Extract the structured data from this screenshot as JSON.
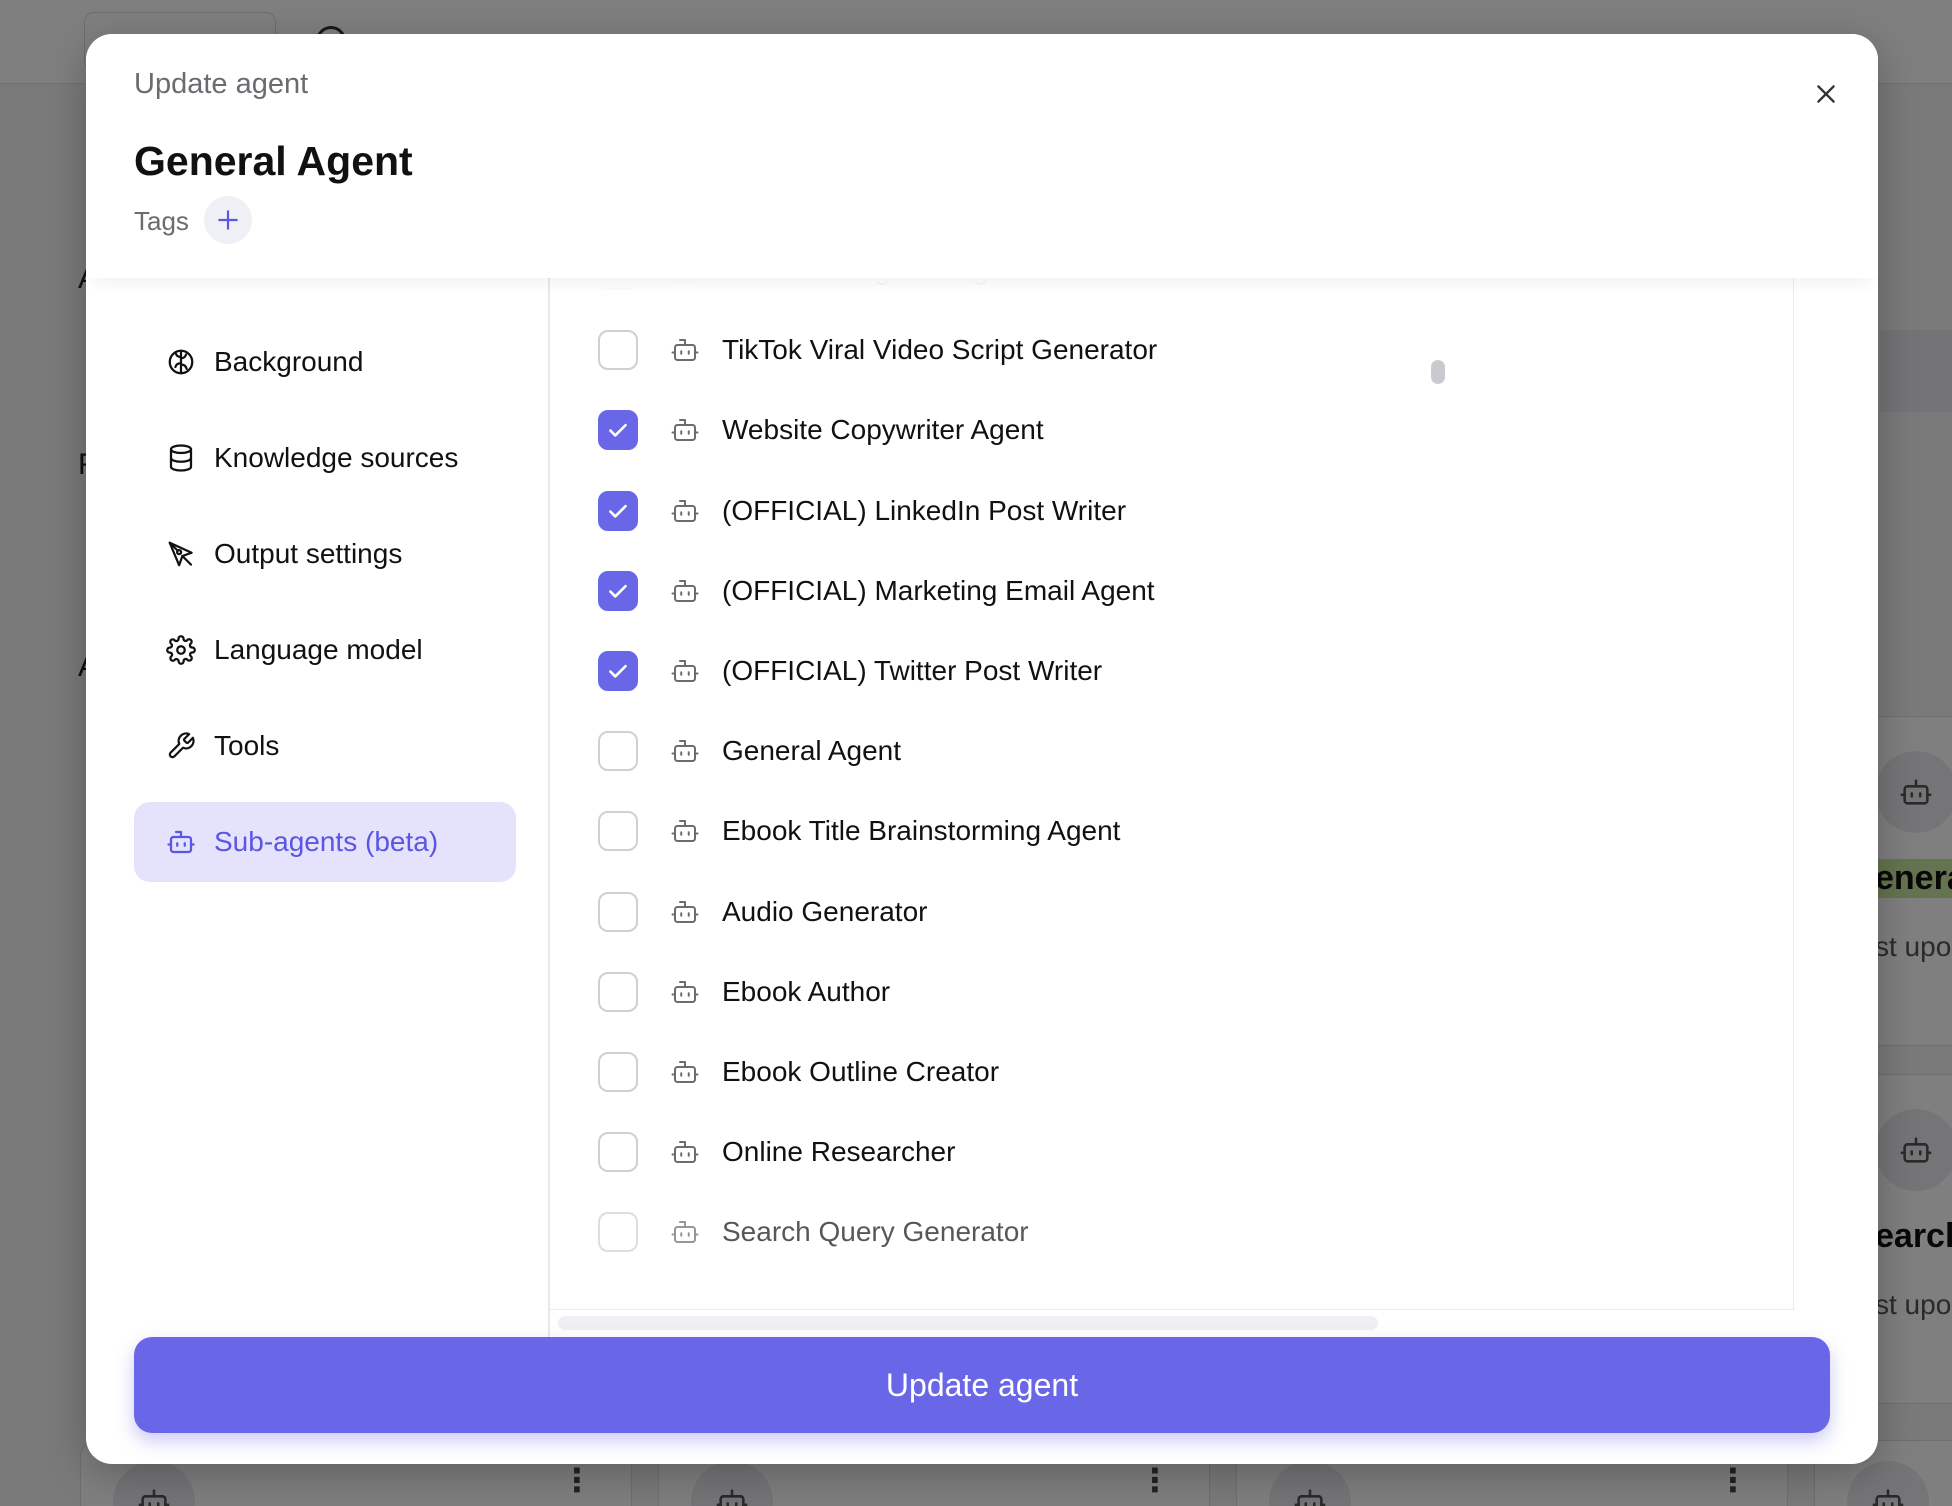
{
  "dialog": {
    "label": "Update agent",
    "agent_name": "General Agent",
    "tags_label": "Tags",
    "submit_label": "Update agent"
  },
  "nav": {
    "items": [
      {
        "label": "Background",
        "icon": "brain-icon",
        "active": false
      },
      {
        "label": "Knowledge sources",
        "icon": "database-icon",
        "active": false
      },
      {
        "label": "Output settings",
        "icon": "pen-tool-icon",
        "active": false
      },
      {
        "label": "Language model",
        "icon": "gear-icon",
        "active": false
      },
      {
        "label": "Tools",
        "icon": "wrench-icon",
        "active": false
      },
      {
        "label": "Sub-agents (beta)",
        "icon": "robot-icon",
        "active": true
      }
    ]
  },
  "sub_agents": [
    {
      "label": "AX Marketing Strategist",
      "checked": false
    },
    {
      "label": "TikTok Viral Video Script Generator",
      "checked": false
    },
    {
      "label": "Website Copywriter Agent",
      "checked": true
    },
    {
      "label": "(OFFICIAL) LinkedIn Post Writer",
      "checked": true
    },
    {
      "label": "(OFFICIAL) Marketing Email Agent",
      "checked": true
    },
    {
      "label": "(OFFICIAL) Twitter Post Writer",
      "checked": true
    },
    {
      "label": "General Agent",
      "checked": false
    },
    {
      "label": "Ebook Title Brainstorming Agent",
      "checked": false
    },
    {
      "label": "Audio Generator",
      "checked": false
    },
    {
      "label": "Ebook Author",
      "checked": false
    },
    {
      "label": "Ebook Outline Creator",
      "checked": false
    },
    {
      "label": "Online Researcher",
      "checked": false
    },
    {
      "label": "Search Query Generator",
      "checked": false
    }
  ],
  "background": {
    "card_1_title": "enera",
    "card_1_sub": "st upo",
    "card_2_title": "earch",
    "card_2_sub": "st upo",
    "side_letters": [
      "A",
      "F",
      "A"
    ]
  },
  "colors": {
    "accent": "#6966e8",
    "active_nav_bg": "#e4e3fb",
    "overlay": "rgba(0,0,0,0.5)"
  }
}
